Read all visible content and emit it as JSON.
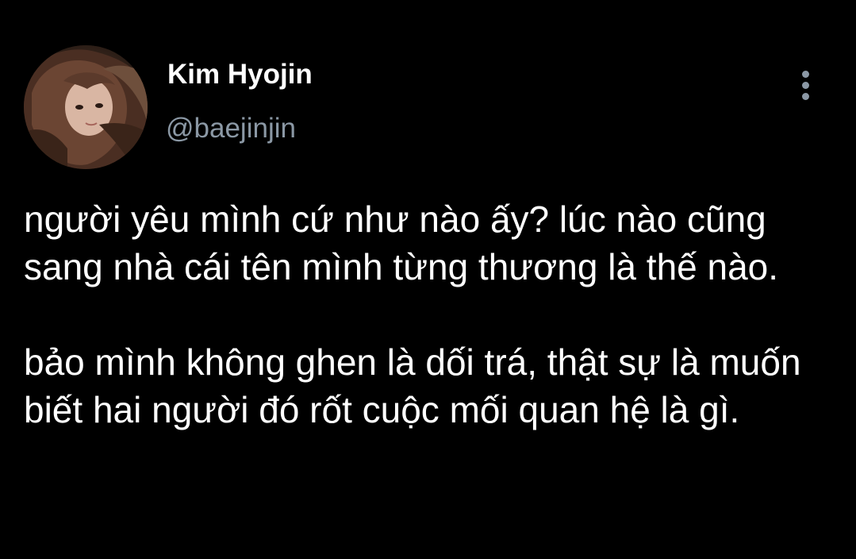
{
  "author": {
    "display_name": "Kim Hyojin",
    "handle": "@baejinjin",
    "avatar_icon": "profile-photo-avatar"
  },
  "menu": {
    "icon": "more-vertical-icon"
  },
  "tweet": {
    "paragraphs": [
      "người yêu mình cứ như nào ấy? lúc nào cũng sang nhà cái tên mình từng thương là thế nào.",
      "bảo mình không ghen là dối trá, thật sự là muốn biết hai người đó rốt cuộc mối quan hệ là gì."
    ]
  },
  "colors": {
    "background": "#000000",
    "text_primary": "#ffffff",
    "text_secondary": "#8b98a5"
  }
}
